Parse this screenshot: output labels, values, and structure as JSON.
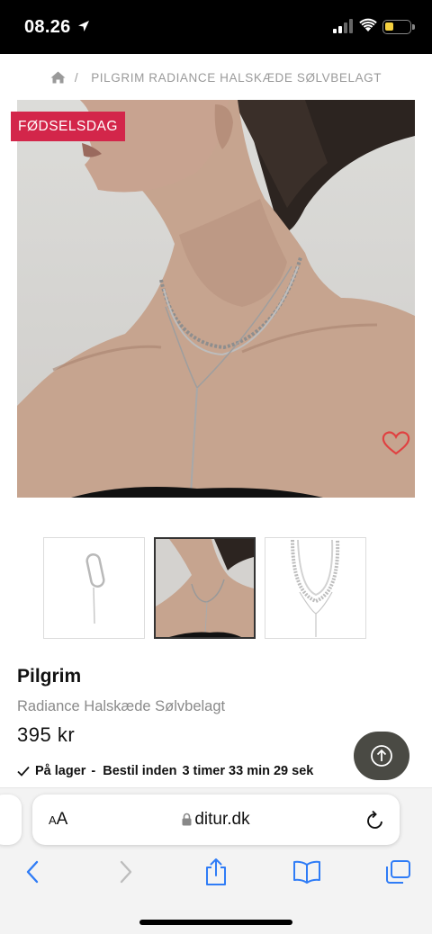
{
  "status_bar": {
    "time": "08.26"
  },
  "breadcrumb": {
    "current": "PILGRIM RADIANCE HALSKÆDE SØLVBELAGT",
    "separator": "/"
  },
  "product": {
    "badge": "FØDSELSDAG",
    "brand": "Pilgrim",
    "name": "Radiance Halskæde Sølvbelagt",
    "price": "395 kr",
    "stock_label": "På lager",
    "stock_separator": "-",
    "order_prefix": "Bestil inden",
    "countdown": "3 timer 33 min 29 sek",
    "thumbnails": [
      {
        "label": "thumbnail-pendant"
      },
      {
        "label": "thumbnail-model"
      },
      {
        "label": "thumbnail-chain"
      }
    ],
    "selected_thumbnail": 1,
    "accent_color": "#d3264a"
  },
  "browser": {
    "text_size_label_small": "A",
    "text_size_label_large": "A",
    "domain": "ditur.dk"
  },
  "icons": {
    "home": "home-icon",
    "heart": "heart-icon",
    "scroll_top": "arrow-up-circle-icon",
    "back": "chevron-left-icon",
    "forward": "chevron-right-icon",
    "share": "share-icon",
    "bookmarks": "book-icon",
    "tabs": "tabs-icon"
  }
}
